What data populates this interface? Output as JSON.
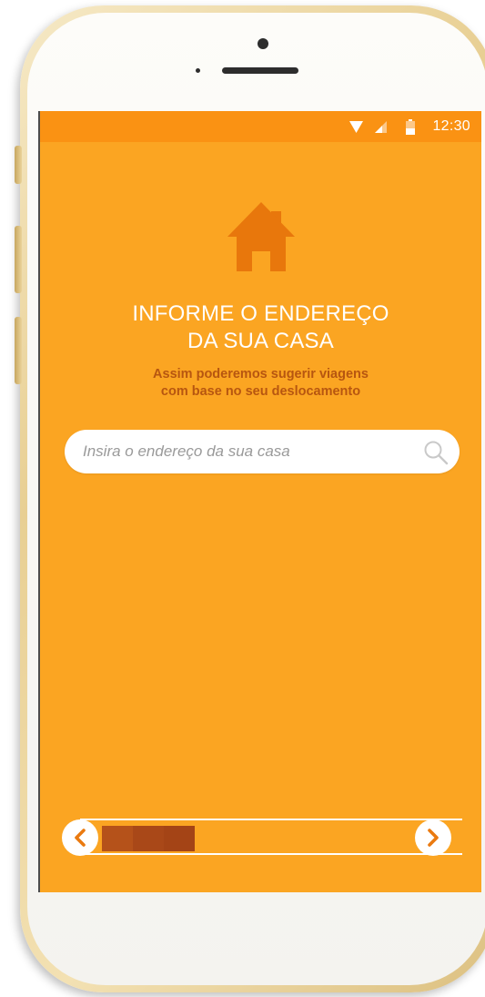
{
  "status_bar": {
    "time": "12:30",
    "icons": [
      "wifi-icon",
      "signal-icon",
      "battery-icon"
    ]
  },
  "onboarding": {
    "icon": "house-icon",
    "title_line1": "INFORME O ENDEREÇO",
    "title_line2": "DA SUA CASA",
    "subtitle_line1": "Assim poderemos sugerir viagens",
    "subtitle_line2": "com base no seu deslocamento"
  },
  "search": {
    "placeholder": "Insira o endereço da sua casa",
    "value": "",
    "icon": "search-icon"
  },
  "navigation": {
    "prev_icon": "chevron-left-icon",
    "next_icon": "chevron-right-icon",
    "progress_fraction": 0.24
  },
  "colors": {
    "background": "#fba522",
    "status_bar": "#fa9213",
    "accent_dark": "#e8770c",
    "subtitle": "#b75610",
    "progress_segments": [
      "#b5521a",
      "#a94818",
      "#a44416"
    ]
  }
}
